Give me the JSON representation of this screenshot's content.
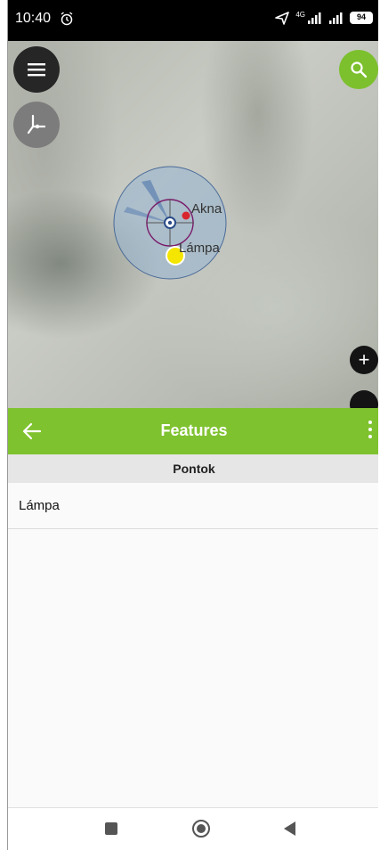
{
  "status_bar": {
    "time": "10:40",
    "network": "4G",
    "battery": "94"
  },
  "map": {
    "labels": [
      "Akna",
      "Lámpa"
    ],
    "icons": {
      "menu": "hamburger-menu-icon",
      "crosshair": "crosshair-icon",
      "search": "search-icon",
      "zoom_in": "+"
    },
    "colors": {
      "accent": "#7fc22f",
      "point_red": "#d8262f",
      "point_yellow": "#f4e600"
    }
  },
  "features_panel": {
    "title": "Features",
    "section": "Pontok",
    "items": [
      "Lámpa"
    ]
  }
}
